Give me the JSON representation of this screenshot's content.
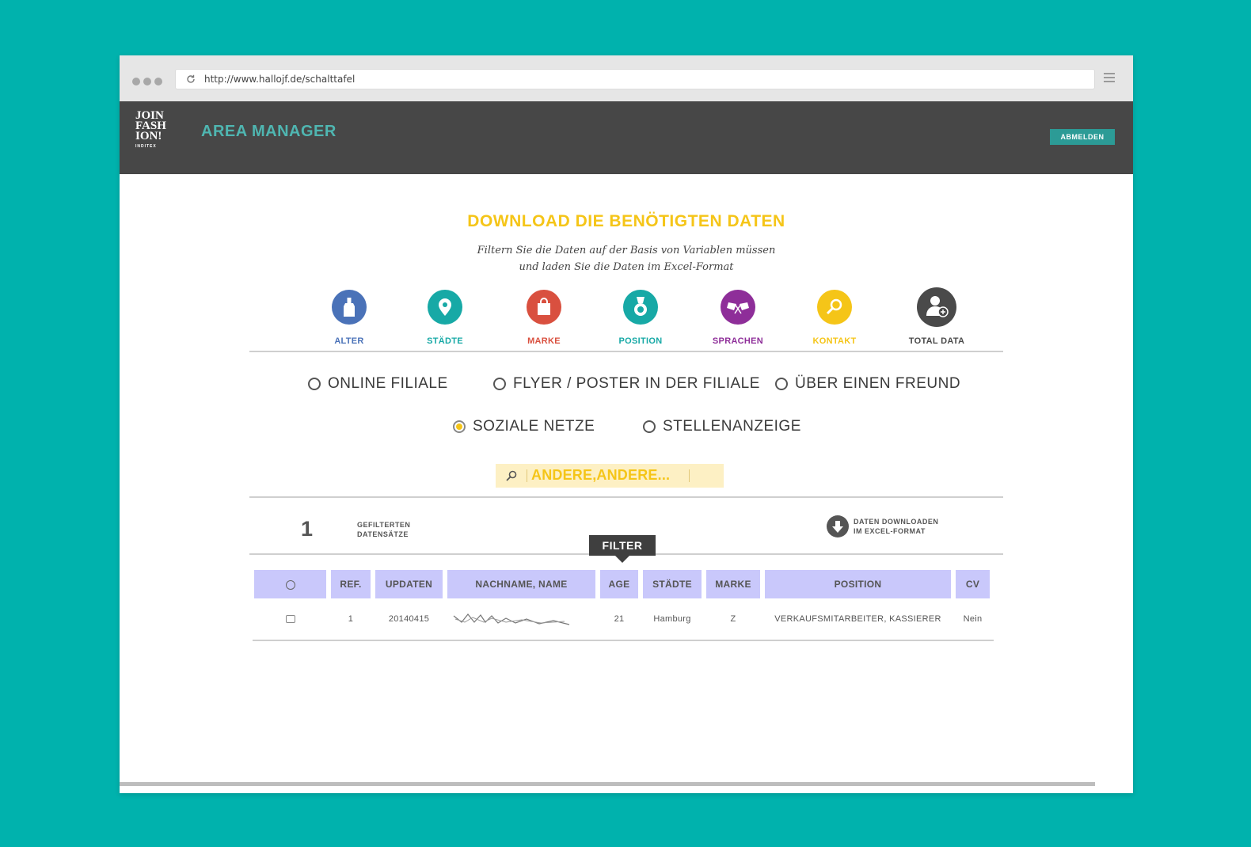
{
  "browser": {
    "url": "http://www.hallojf.de/schalttafel"
  },
  "header": {
    "logo_lines": [
      "JOIN",
      "FASH",
      "ION!",
      "INDITEX"
    ],
    "title": "AREA MANAGER",
    "logout_label": "ABMELDEN"
  },
  "main": {
    "heading": "DOWNLOAD DIE BENÖTIGTEN DATEN",
    "subtitle_line1": "Filtern Sie die Daten auf der Basis von Variablen müssen",
    "subtitle_line2": "und laden Sie die Daten im Excel-Format"
  },
  "categories": [
    {
      "label": "ALTER",
      "icon": "bottle-icon",
      "color": "#4a72b8"
    },
    {
      "label": "STÄDTE",
      "icon": "map-pin-icon",
      "color": "#17a9a6"
    },
    {
      "label": "MARKE",
      "icon": "shopping-bag-icon",
      "color": "#d9503f"
    },
    {
      "label": "POSITION",
      "icon": "medal-icon",
      "color": "#17a9a6"
    },
    {
      "label": "SPRACHEN",
      "icon": "flags-icon",
      "color": "#8e2e99"
    },
    {
      "label": "KONTAKT",
      "icon": "magnifier-icon",
      "color": "#f5c518"
    },
    {
      "label": "TOTAL DATA",
      "icon": "user-add-icon",
      "color": "#4a4a4a"
    }
  ],
  "sources": {
    "online_filiale": "ONLINE FILIALE",
    "flyer_poster": "FLYER / POSTER IN DER FILIALE",
    "ueber_freund": "ÜBER EINEN FREUND",
    "soziale_netze": "SOZIALE NETZE",
    "stellenanzeige": "STELLENANZEIGE",
    "selected": "SOZIALE NETZE"
  },
  "search": {
    "value": "ANDERE,ANDERE..."
  },
  "summary": {
    "count": "1",
    "count_label_1": "GEFILTERTEN",
    "count_label_2": "DATENSÄTZE",
    "download_label_1": "DATEN DOWNLOADEN",
    "download_label_2": "IM EXCEL-FORMAT",
    "filter_label": "FILTER"
  },
  "table": {
    "columns": [
      "REF.",
      "UPDATEN",
      "NACHNAME, NAME",
      "AGE",
      "STÄDTE",
      "MARKE",
      "POSITION",
      "CV"
    ],
    "rows": [
      {
        "ref": "1",
        "updaten": "20140415",
        "age": "21",
        "staedte": "Hamburg",
        "marke": "Z",
        "position": "VERKAUFSMITARBEITER, KASSIERER",
        "cv": "Nein"
      }
    ]
  }
}
